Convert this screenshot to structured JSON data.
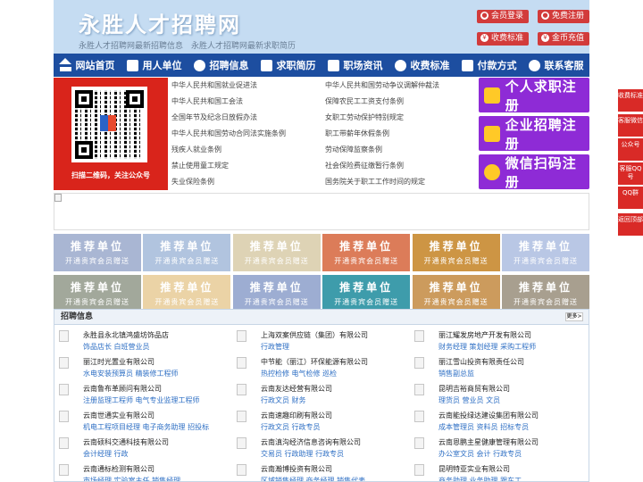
{
  "header": {
    "site_title": "永胜人才招聘网",
    "subtitle": "永胜人才招聘网最新招聘信息　永胜人才招聘网最新求职简历",
    "buttons": [
      {
        "label": "会员登录",
        "icon": "user-icon"
      },
      {
        "label": "免费注册",
        "icon": "user-icon"
      },
      {
        "label": "收费标准",
        "icon": "yen-icon"
      },
      {
        "label": "金币充值",
        "icon": "coin-icon"
      }
    ]
  },
  "nav": [
    {
      "label": "网站首页",
      "icon": "home-icon"
    },
    {
      "label": "用人单位",
      "icon": "building-icon"
    },
    {
      "label": "招聘信息",
      "icon": "user-icon"
    },
    {
      "label": "求职简历",
      "icon": "pen-icon"
    },
    {
      "label": "职场资讯",
      "icon": "document-icon"
    },
    {
      "label": "收费标准",
      "icon": "yen-icon"
    },
    {
      "label": "付款方式",
      "icon": "card-icon"
    },
    {
      "label": "联系客服",
      "icon": "phone-icon"
    }
  ],
  "qr": {
    "caption": "扫描二维码，关注公众号"
  },
  "laws": [
    "中华人民共和国就业促进法",
    "中华人民共和国劳动争议调解仲裁法",
    "中华人民共和国工会法",
    "保障农民工工资支付条例",
    "全国年节及纪念日放假办法",
    "女职工劳动保护特别规定",
    "中华人民共和国劳动合同法实施条例",
    "职工带薪年休假条例",
    "残疾人就业条例",
    "劳动保障监察条例",
    "禁止使用童工规定",
    "社会保险费征缴暂行条例",
    "失业保险条例",
    "国务院关于职工工作时间的规定"
  ],
  "register": [
    {
      "label": "个人求职注册",
      "icon": "person-icon"
    },
    {
      "label": "企业招聘注册",
      "icon": "company-icon"
    },
    {
      "label": "微信扫码注册",
      "icon": "wechat-icon"
    }
  ],
  "recommend": {
    "title": "推荐单位",
    "subtitle": "开通贵宾会员赠送",
    "colors": [
      "#a9b6d3",
      "#b1c4df",
      "#ded3b5",
      "#dc7c59",
      "#cd9544",
      "#b9c7e5",
      "#a2a89b",
      "#ebd3a6",
      "#9dadd2",
      "#3e9cab",
      "#cc9b5d",
      "#a89f8f"
    ]
  },
  "jobs": {
    "title": "招聘信息",
    "more": "更多>",
    "items": [
      {
        "company": "永胜县永北镇鸿盛坊饰品店",
        "positions": "饰品店长 白班营业员"
      },
      {
        "company": "上海双案供应链（集团）有限公司",
        "positions": "行政管理"
      },
      {
        "company": "丽江耀发房地产开发有限公司",
        "positions": "财务经理 策划经理 采购工程师"
      },
      {
        "company": "丽江时光置业有限公司",
        "positions": "水电安装预算员 精装修工程师"
      },
      {
        "company": "中节能（丽江）环保能源有限公司",
        "positions": "热控检修 电气检修 巡检"
      },
      {
        "company": "丽江雪山投资有限责任公司",
        "positions": "销售副总监"
      },
      {
        "company": "云南鲁布革顾问有限公司",
        "positions": "注册监理工程师 电气专业监理工程师"
      },
      {
        "company": "云南友达经营有限公司",
        "positions": "行政文员 财务"
      },
      {
        "company": "昆明吉裕商贸有限公司",
        "positions": "理货员 营业员 文员"
      },
      {
        "company": "云南世通实业有限公司",
        "positions": "机电工程项目经理 电子商务助理 招投标"
      },
      {
        "company": "云南速趣印刷有限公司",
        "positions": "行政文员 行政专员"
      },
      {
        "company": "云南能投绿达建设集团有限公司",
        "positions": "成本管理员 资料员 招标专员"
      },
      {
        "company": "云南硕科交通科技有限公司",
        "positions": "会计经理 行政"
      },
      {
        "company": "云南滇沟经济信息咨询有限公司",
        "positions": "交易员 行政助理 行政专员"
      },
      {
        "company": "云南恩鹏主星健康管理有限公司",
        "positions": "办公室文员 会计 行政专员"
      },
      {
        "company": "云南通标检测有限公司",
        "positions": "市场经理 实验室主任 销售经理"
      },
      {
        "company": "云南瀚博投资有限公司",
        "positions": "区域销售经理 商务经理 销售代表"
      },
      {
        "company": "昆明特亚实业有限公司",
        "positions": "商务助理 业务助理 跟车工"
      }
    ]
  },
  "side_tabs": [
    "收费标准",
    "客服微信",
    "公众号",
    "客服QQ号",
    "QQ群",
    "返回顶部"
  ]
}
